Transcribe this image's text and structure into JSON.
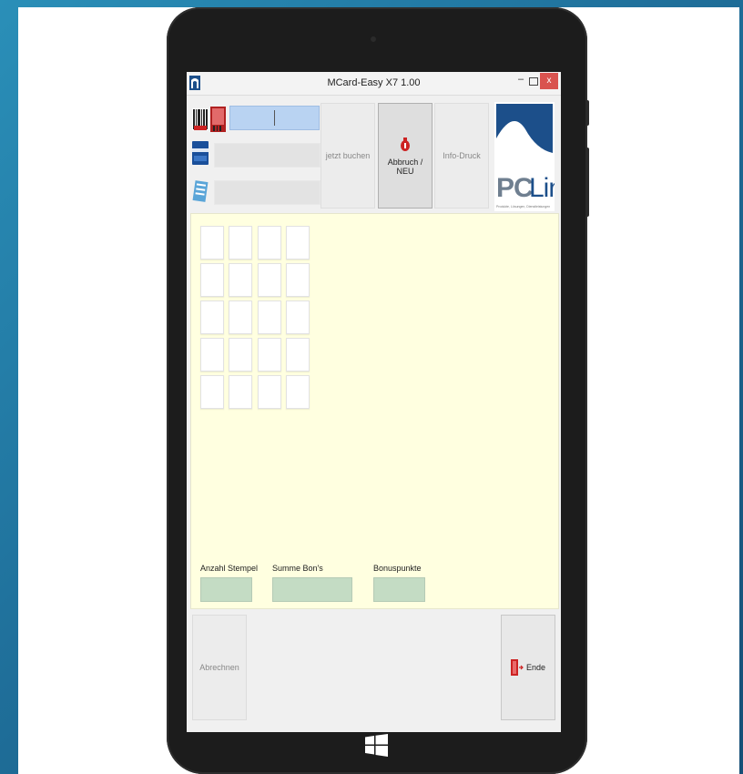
{
  "window": {
    "title": "MCard-Easy X7 1.00",
    "minimize_glyph": "–",
    "close_glyph": "x"
  },
  "toolbar": {
    "buchen_label": "jetzt buchen",
    "abbruch_label": "Abbruch / NEU",
    "infodruck_label": "Info-Druck"
  },
  "logo": {
    "text_pc": "PC",
    "text_lin": "Lin",
    "tagline": "Produkte, Lösungen, Dienstleistungen"
  },
  "stats": {
    "stempel_label": "Anzahl Stempel",
    "summe_label": "Summe Bon's",
    "bonus_label": "Bonuspunkte"
  },
  "footer": {
    "abrechnen_label": "Abrechnen",
    "ende_label": "Ende"
  },
  "colors": {
    "active_field": "#b9d3f2",
    "content_bg": "#ffffe0",
    "result_field": "#c4dcc4",
    "close_button": "#d9534f",
    "logo_blue": "#1c4f8a"
  }
}
